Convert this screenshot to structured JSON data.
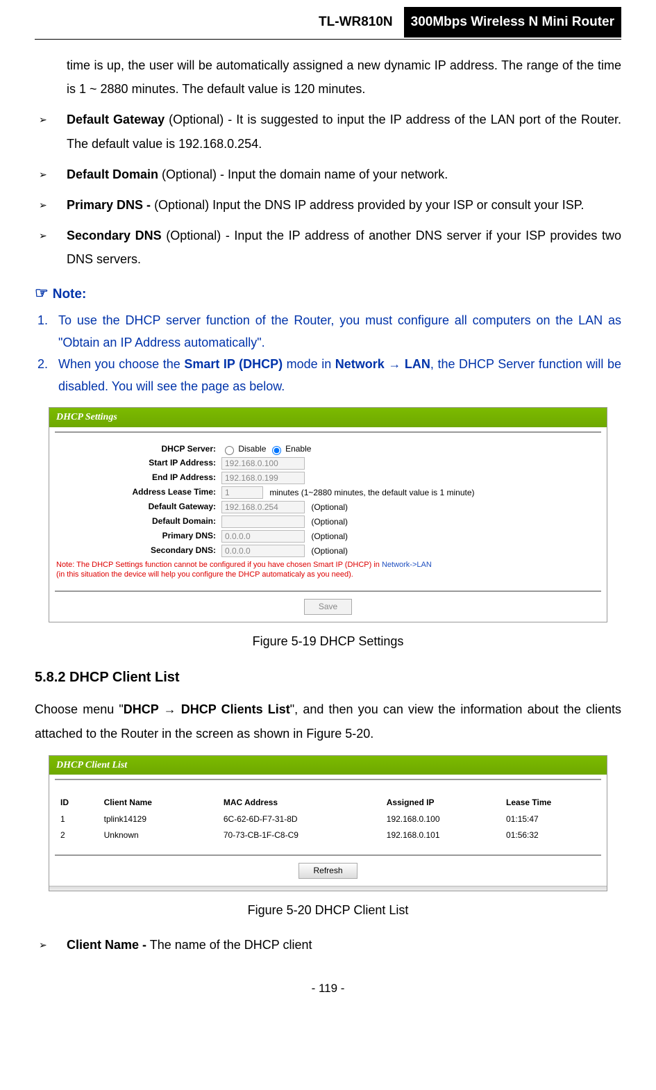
{
  "header": {
    "model": "TL-WR810N",
    "product": "300Mbps Wireless N Mini Router"
  },
  "intro_continuation": "time is up, the user will be automatically assigned a new dynamic IP address. The range of the time is 1 ~ 2880 minutes. The default value is 120 minutes.",
  "bullets1": [
    {
      "term": "Default Gateway",
      "mid": " (Optional) - ",
      "text": "It is suggested to input the IP address of the LAN port of the Router. The default value is 192.168.0.254."
    },
    {
      "term": "Default Domain",
      "mid": " (Optional) - ",
      "text": "Input the domain name of your network."
    },
    {
      "term": "Primary DNS -",
      "mid": " ",
      "text": "(Optional) Input the DNS IP address provided by your ISP or consult your ISP."
    },
    {
      "term": "Secondary DNS",
      "mid": " (Optional) - ",
      "text": "Input the IP address of another DNS server if your ISP provides two DNS servers."
    }
  ],
  "note_header": "Note:",
  "note_list": {
    "item1": "To use the DHCP server function of the Router, you must configure all computers on the LAN as \"Obtain an IP Address automatically\".",
    "item2_a": "When you choose the ",
    "item2_b": "Smart IP (DHCP)",
    "item2_c": " mode in ",
    "item2_d": "Network → LAN",
    "item2_e": ", the DHCP Server function will be disabled. You will see the page as below."
  },
  "dhcp_settings": {
    "title": "DHCP Settings",
    "labels": {
      "server": "DHCP Server:",
      "start": "Start IP Address:",
      "end": "End IP Address:",
      "lease": "Address Lease Time:",
      "gateway": "Default Gateway:",
      "domain": "Default Domain:",
      "pdns": "Primary DNS:",
      "sdns": "Secondary DNS:"
    },
    "radio_disable": "Disable",
    "radio_enable": "Enable",
    "values": {
      "start": "192.168.0.100",
      "end": "192.168.0.199",
      "lease": "1",
      "gateway": "192.168.0.254",
      "domain": "",
      "pdns": "0.0.0.0",
      "sdns": "0.0.0.0"
    },
    "lease_hint": "minutes (1~2880 minutes, the default value is 1 minute)",
    "optional": "(Optional)",
    "red_note1": "Note: The DHCP Settings function cannot be configured if you have chosen Smart IP (DHCP) in ",
    "red_note1b": "Network->LAN",
    "red_note2": "(in this situation the device will help you configure the DHCP automaticaly as you need).",
    "save": "Save"
  },
  "fig519": "Figure 5-19 DHCP Settings",
  "section_582": "5.8.2   DHCP Client List",
  "para582_a": "Choose menu \"",
  "para582_b": "DHCP → DHCP Clients List",
  "para582_c": "\", and then you can view the information about the clients attached to the Router in the screen as shown in Figure 5-20.",
  "client_list": {
    "title": "DHCP Client List",
    "headers": {
      "id": "ID",
      "name": "Client Name",
      "mac": "MAC Address",
      "ip": "Assigned IP",
      "lease": "Lease Time"
    },
    "rows": [
      {
        "id": "1",
        "name": "tplink14129",
        "mac": "6C-62-6D-F7-31-8D",
        "ip": "192.168.0.100",
        "lease": "01:15:47"
      },
      {
        "id": "2",
        "name": "Unknown",
        "mac": "70-73-CB-1F-C8-C9",
        "ip": "192.168.0.101",
        "lease": "01:56:32"
      }
    ],
    "refresh": "Refresh"
  },
  "fig520": "Figure 5-20    DHCP Client List",
  "bullets2": [
    {
      "term": "Client Name -",
      "text": " The name of the DHCP client"
    }
  ],
  "page_number": "- 119 -"
}
